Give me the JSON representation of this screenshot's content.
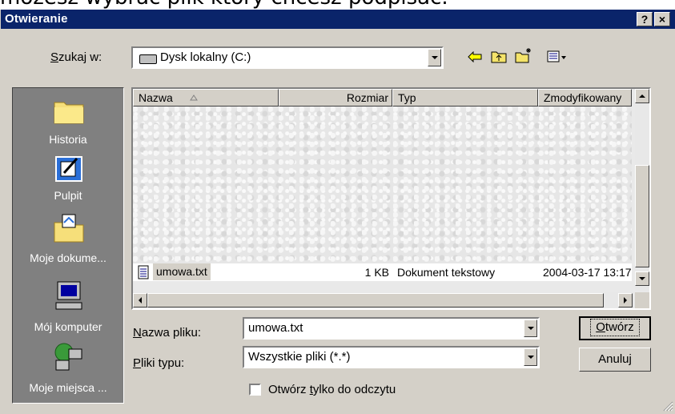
{
  "top_text": "możesz wybrać plik który chcesz podpisać.",
  "window": {
    "title": "Otwieranie",
    "help_button": "?",
    "close_button": "×"
  },
  "lookin": {
    "label_prefix": "S",
    "label_rest": "zukaj w:",
    "value": "Dysk lokalny (C:)"
  },
  "toolbar_icons": [
    "back-arrow-icon",
    "up-folder-icon",
    "new-folder-icon",
    "view-menu-icon"
  ],
  "places": [
    {
      "label": "Historia",
      "icon": "history-folder-icon"
    },
    {
      "label": "Pulpit",
      "icon": "desktop-icon"
    },
    {
      "label": "Moje dokume...",
      "icon": "my-documents-icon"
    },
    {
      "label": "Mój komputer",
      "icon": "my-computer-icon"
    },
    {
      "label": "Moje miejsca ...",
      "icon": "network-places-icon"
    }
  ],
  "columns": {
    "name": "Nazwa",
    "size": "Rozmiar",
    "type": "Typ",
    "modified": "Zmodyfikowany"
  },
  "files": [
    {
      "name": "umowa.txt",
      "size": "1 KB",
      "type": "Dokument tekstowy",
      "modified": "2004-03-17 13:17"
    }
  ],
  "filename": {
    "label_prefix": "N",
    "label_rest": "azwa pliku:",
    "value": "umowa.txt"
  },
  "filetype": {
    "label_prefix": "P",
    "label_rest": "liki typu:",
    "value": "Wszystkie pliki (*.*)"
  },
  "readonly": {
    "label_before": "Otwórz ",
    "label_ul": "t",
    "label_after": "ylko do odczytu",
    "checked": false
  },
  "buttons": {
    "open_ul": "O",
    "open_rest": "twórz",
    "cancel": "Anuluj"
  }
}
